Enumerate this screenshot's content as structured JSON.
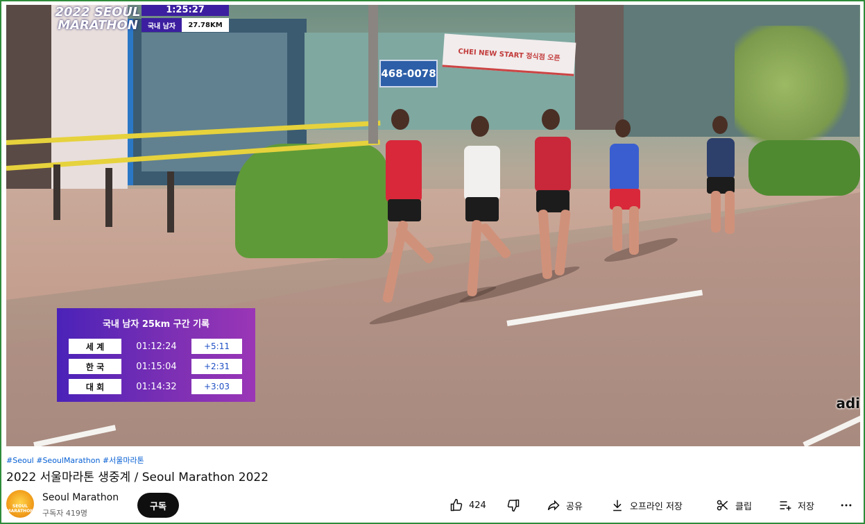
{
  "video": {
    "brand_line1": "2022 SEOUL",
    "brand_line2": "MARATHON",
    "elapsed_time": "1:25:27",
    "split_label": "국내 남자",
    "split_distance": "27.78KM",
    "street_sign": "468-0078",
    "shop_banner": "CHEI NEW START 정식점 오픈",
    "sponsor_logo": "adi",
    "record_board": {
      "title": "국내 남자 25km 구간 기록",
      "rows": [
        {
          "label": "세 계",
          "time": "01:12:24",
          "diff": "+5:11"
        },
        {
          "label": "한 국",
          "time": "01:15:04",
          "diff": "+2:31"
        },
        {
          "label": "대 회",
          "time": "01:14:32",
          "diff": "+3:03"
        }
      ]
    }
  },
  "meta": {
    "hashtags": "#Seoul #SeoulMarathon #서울마라톤",
    "title": "2022 서울마라톤 생중계 / Seoul Marathon 2022"
  },
  "channel": {
    "name": "Seoul Marathon",
    "subscribers": "구독자 419명",
    "subscribe_label": "구독",
    "avatar_text": "SEOUL MARATHON"
  },
  "actions": {
    "like_count": "424",
    "share_label": "공유",
    "download_label": "오프라인 저장",
    "clip_label": "클립",
    "save_label": "저장"
  },
  "colors": {
    "overlay_purple": "#3c1fa0",
    "link_blue": "#065fd4",
    "frame_green": "#2e8b3a"
  }
}
